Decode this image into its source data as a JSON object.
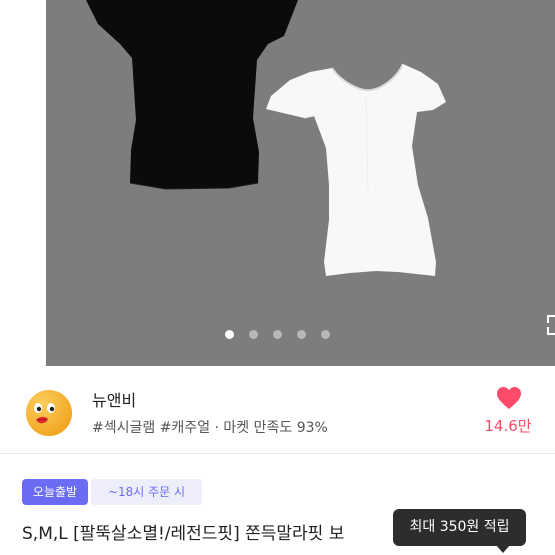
{
  "gallery": {
    "total_images": 5,
    "active_index": 0
  },
  "seller": {
    "name": "뉴앤비",
    "meta": "#섹시글램 #캐주얼 · 마켓 만족도 93%",
    "like_count": "14.6만"
  },
  "badges": {
    "shipping": "오늘출발",
    "cutoff": "~18시 주문 시"
  },
  "product": {
    "title": "S,M,L [팔뚝살소멸!/레전드핏] 쫀득말라핏 보"
  },
  "tooltip": {
    "text": "최대 350원 적립"
  },
  "colors": {
    "hero_background": "#7d7d7d",
    "accent": "#6b6bf4",
    "like": "#ff4a6b"
  }
}
